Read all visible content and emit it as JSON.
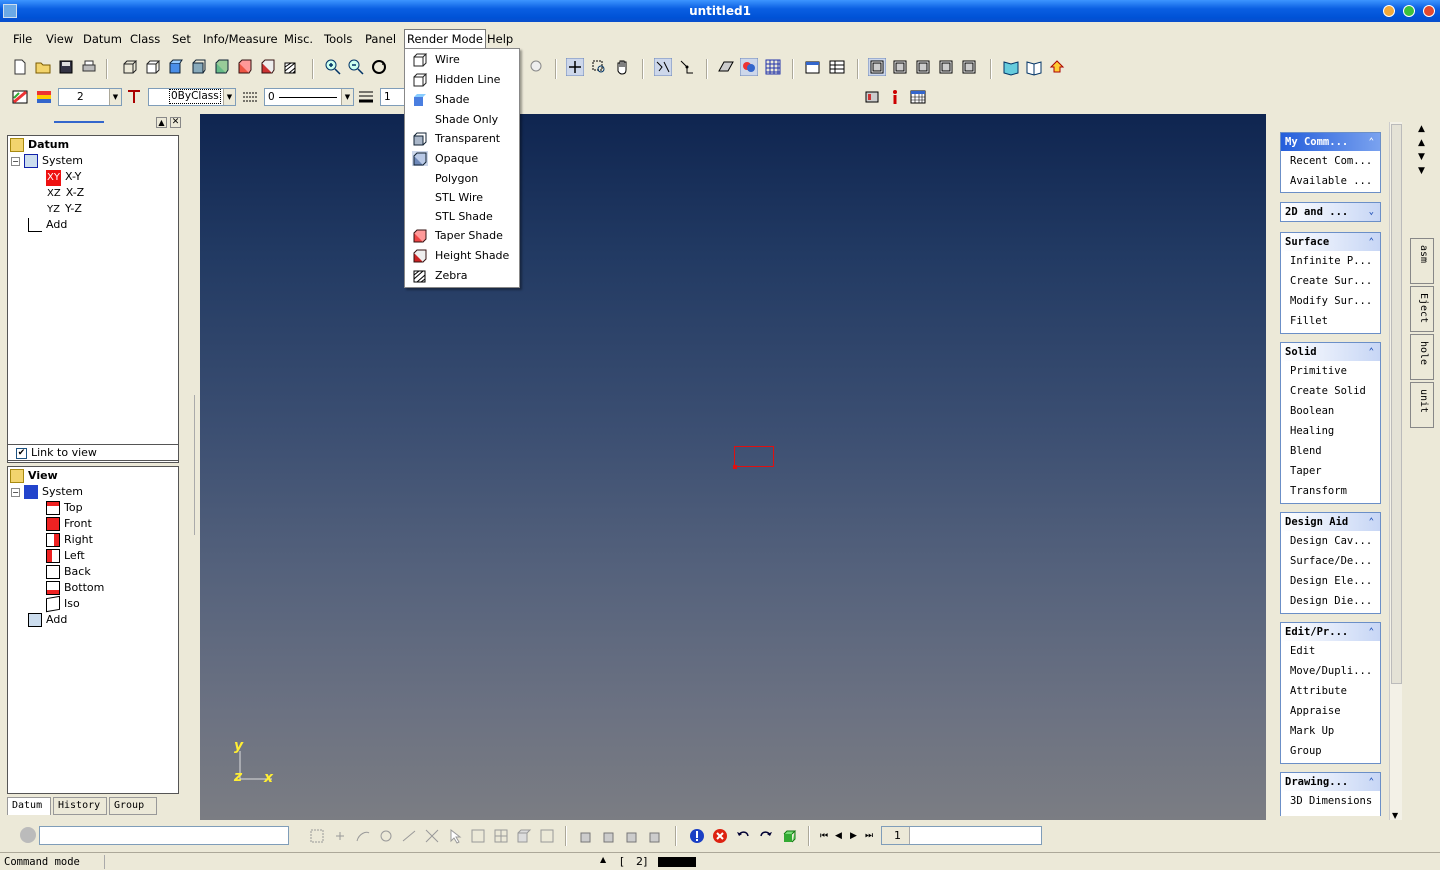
{
  "window": {
    "title": "untitled1"
  },
  "menubar": {
    "items": [
      "File",
      "View",
      "Datum",
      "Class",
      "Set",
      "Info/Measure",
      "Misc.",
      "Tools",
      "Panel",
      "Render Mode",
      "Help"
    ]
  },
  "toolbar2": {
    "line_width": "2",
    "class_field": "0ByClass",
    "line_style": "0",
    "line_count": "1"
  },
  "render_menu": {
    "items": [
      {
        "label": "Wire",
        "icon": "wire-cube-icon"
      },
      {
        "label": "Hidden Line",
        "icon": "hidden-line-cube-icon"
      },
      {
        "label": "Shade",
        "icon": "shade-icon"
      },
      {
        "label": "Shade Only",
        "icon": ""
      },
      {
        "label": "Transparent",
        "icon": "transparent-cube-icon"
      },
      {
        "label": "Opaque",
        "icon": "opaque-cube-icon"
      },
      {
        "label": "Polygon",
        "icon": ""
      },
      {
        "label": "STL Wire",
        "icon": ""
      },
      {
        "label": "STL Shade",
        "icon": ""
      },
      {
        "label": "Taper Shade",
        "icon": "taper-shade-icon"
      },
      {
        "label": "Height Shade",
        "icon": "height-shade-icon"
      },
      {
        "label": "Zebra",
        "icon": "zebra-icon"
      }
    ]
  },
  "datum_tree": {
    "root": "Datum",
    "system": "System",
    "items": [
      {
        "tag": "XY",
        "label": "X-Y"
      },
      {
        "tag": "XZ",
        "label": "X-Z"
      },
      {
        "tag": "YZ",
        "label": "Y-Z"
      }
    ],
    "add": "Add",
    "link_to_view": "Link to view"
  },
  "view_tree": {
    "root": "View",
    "system": "System",
    "items": [
      "Top",
      "Front",
      "Right",
      "Left",
      "Back",
      "Bottom",
      "Iso"
    ],
    "add": "Add"
  },
  "left_tabs": [
    "Datum",
    "History",
    "Group"
  ],
  "axes": {
    "y": "y",
    "z": "z",
    "x": "x"
  },
  "command_groups": [
    {
      "title": "My Comm...",
      "expanded": true,
      "items": [
        "Recent Com...",
        "Available ..."
      ]
    },
    {
      "title": "2D and ...",
      "expanded": false,
      "items": []
    },
    {
      "title": "Surface",
      "expanded": true,
      "items": [
        "Infinite P...",
        "Create Sur...",
        "Modify Sur...",
        "Fillet"
      ]
    },
    {
      "title": "Solid",
      "expanded": true,
      "items": [
        "Primitive",
        "Create Solid",
        "Boolean",
        "Healing",
        "Blend",
        "Taper",
        "Transform"
      ]
    },
    {
      "title": "Design Aid",
      "expanded": true,
      "items": [
        "Design Cav...",
        "Surface/De...",
        "Design Ele...",
        "Design Die..."
      ]
    },
    {
      "title": "Edit/Pr...",
      "expanded": true,
      "items": [
        "Edit",
        "Move/Dupli...",
        "Attribute",
        "Appraise",
        "Mark Up",
        "Group"
      ]
    },
    {
      "title": "Drawing...",
      "expanded": true,
      "items": [
        "3D Dimensions"
      ]
    }
  ],
  "side_tabs": [
    "asm",
    "Eject",
    "hole",
    "unit"
  ],
  "bottombar": {
    "page_field": "1"
  },
  "statusbar": {
    "mode": "Command mode",
    "bracket": "[",
    "count": "2]"
  },
  "colors": {
    "title_blue": "#0a5fe2",
    "viewport_top": "#0f2550",
    "viewport_bottom": "#7b7d83",
    "selection_red": "#e01010"
  }
}
